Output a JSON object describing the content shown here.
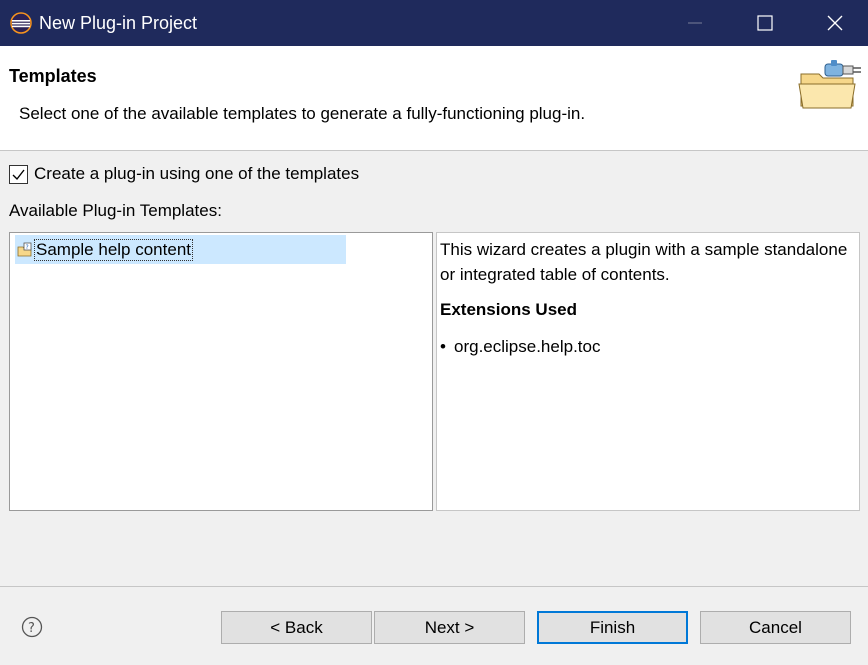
{
  "window": {
    "title": "New Plug-in Project",
    "accent_color": "#1f2a5c"
  },
  "header": {
    "title": "Templates",
    "description": "Select one of the available templates to generate a fully-functioning plug-in.",
    "icon": "folder-plugin-icon"
  },
  "options": {
    "create_from_template_label": "Create a plug-in using one of the templates",
    "create_from_template_checked": true,
    "available_templates_label": "Available Plug-in Templates:"
  },
  "templates": {
    "items": [
      {
        "label": "Sample help content",
        "icon": "help-template-icon",
        "selected": true
      }
    ]
  },
  "details": {
    "description": "This wizard creates a plugin with a sample standalone or integrated table of contents.",
    "extensions_heading": "Extensions Used",
    "extensions": [
      "org.eclipse.help.toc"
    ]
  },
  "footer": {
    "help_icon": "help-icon",
    "back_label": "< Back",
    "next_label": "Next >",
    "finish_label": "Finish",
    "cancel_label": "Cancel"
  }
}
